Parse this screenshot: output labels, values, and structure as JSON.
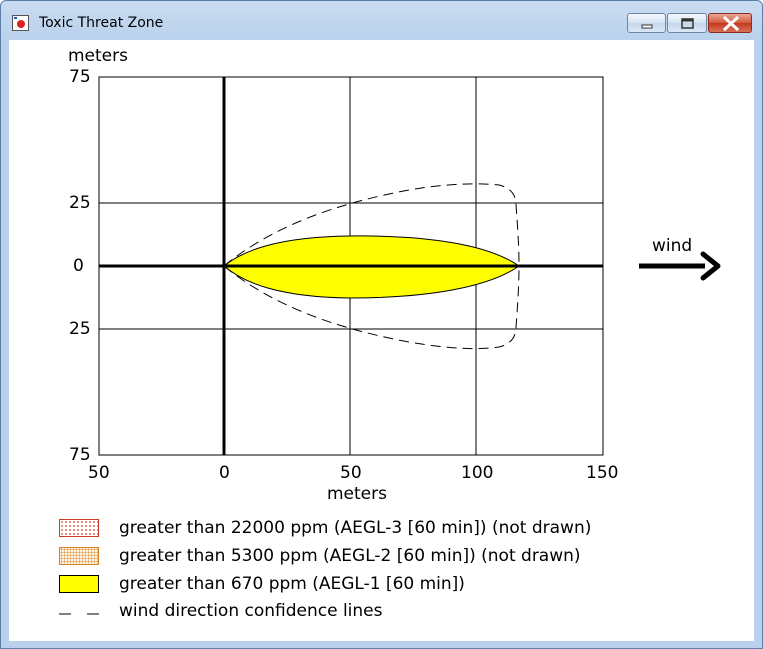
{
  "window": {
    "title": "Toxic Threat Zone",
    "icon": "threat-zone-app-icon",
    "controls": [
      "minimize-icon",
      "maximize-icon",
      "close-icon"
    ]
  },
  "plot": {
    "y_unit": "meters",
    "x_unit": "meters",
    "y_ticks": [
      "75",
      "25",
      "0",
      "25",
      "75"
    ],
    "x_ticks": [
      "50",
      "0",
      "50",
      "100",
      "150"
    ],
    "x_range": [
      -50,
      150
    ],
    "y_range": [
      -75,
      75
    ],
    "wind_label": "wind",
    "wind_arrow_icon": "right-arrow-icon"
  },
  "legend": [
    {
      "swatch": "aegl3",
      "text": "greater than 22000 ppm (AEGL-3 [60 min]) (not drawn)"
    },
    {
      "swatch": "aegl2",
      "text": "greater than 5300 ppm (AEGL-2 [60 min]) (not drawn)"
    },
    {
      "swatch": "aegl1",
      "text": "greater than 670 ppm (AEGL-1 [60 min])"
    },
    {
      "swatch": "dash",
      "text": "wind direction confidence lines"
    }
  ],
  "colors": {
    "aegl1_fill": "#ffff00",
    "aegl3_border": "#d23a2a",
    "aegl2_border": "#d8841f",
    "window_frame": "#b9d1ec"
  }
}
